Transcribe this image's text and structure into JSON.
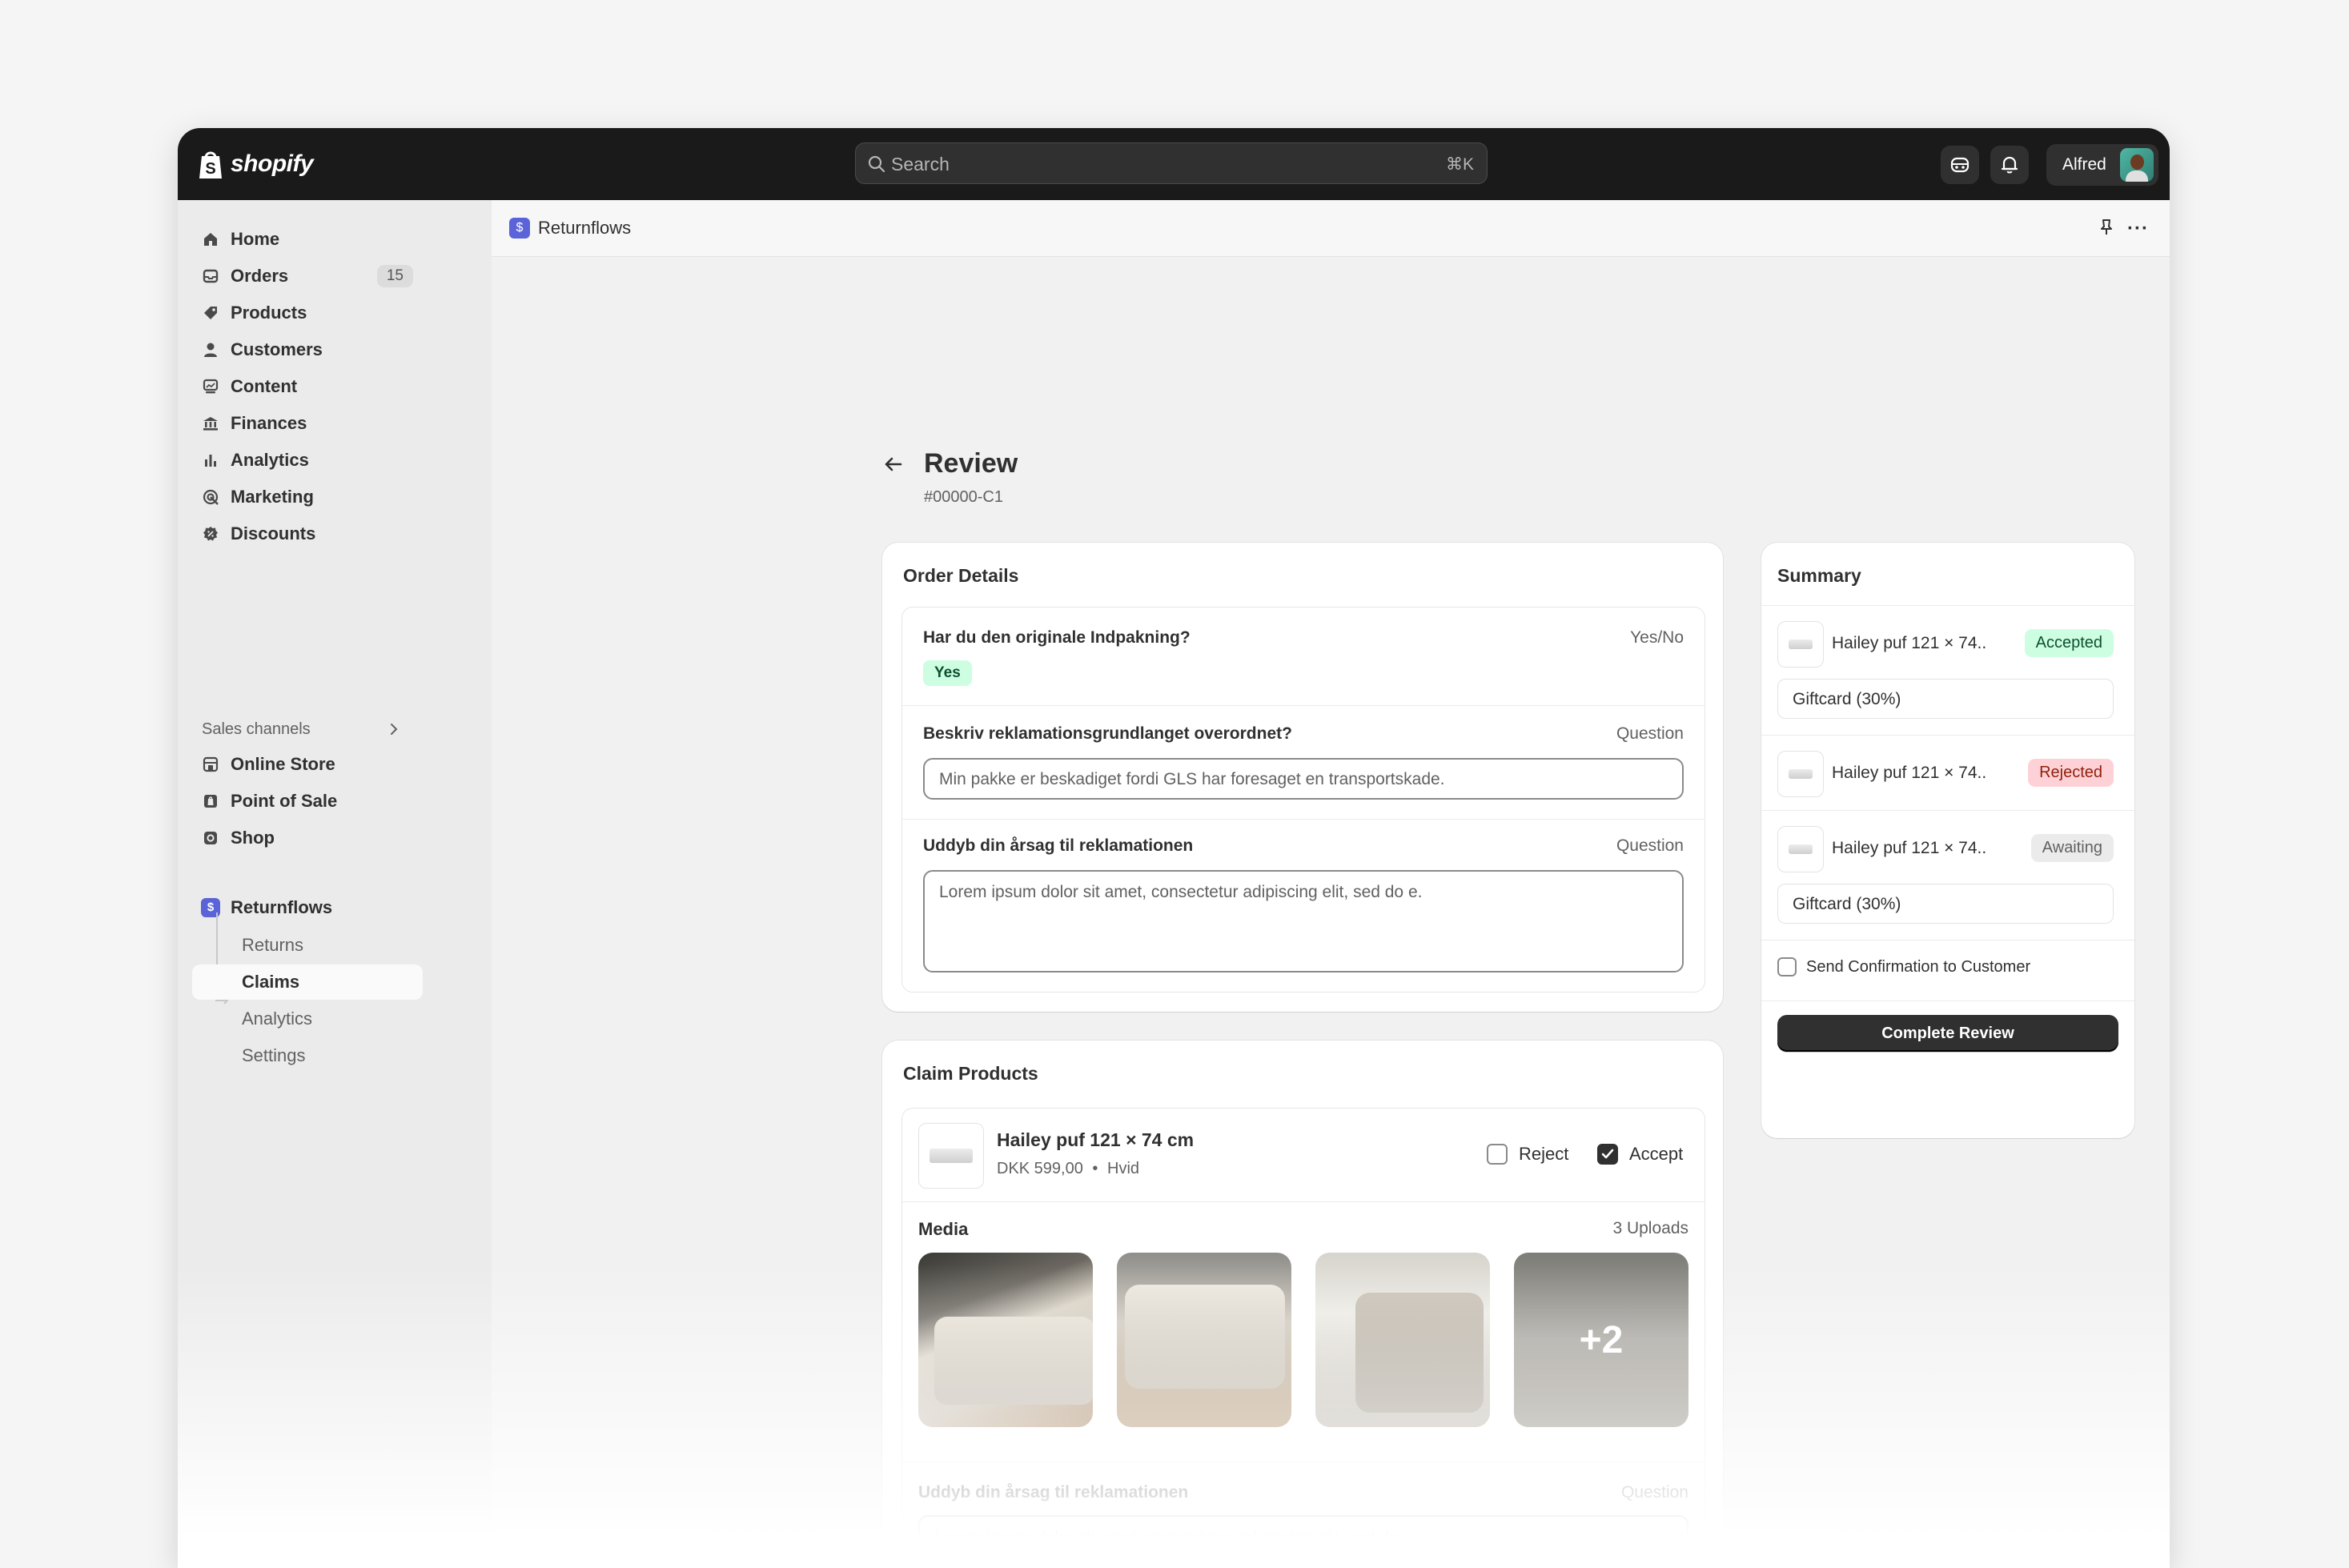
{
  "topbar": {
    "brand": "shopify",
    "search_placeholder": "Search",
    "search_shortcut": "⌘K",
    "user_name": "Alfred"
  },
  "sidebar": {
    "items": [
      {
        "label": "Home",
        "icon": "home-icon"
      },
      {
        "label": "Orders",
        "icon": "inbox-icon",
        "badge": "15"
      },
      {
        "label": "Products",
        "icon": "tag-icon"
      },
      {
        "label": "Customers",
        "icon": "person-icon"
      },
      {
        "label": "Content",
        "icon": "image-icon"
      },
      {
        "label": "Finances",
        "icon": "bank-icon"
      },
      {
        "label": "Analytics",
        "icon": "bar-chart-icon"
      },
      {
        "label": "Marketing",
        "icon": "target-icon"
      },
      {
        "label": "Discounts",
        "icon": "discount-icon"
      }
    ],
    "sales_channels_title": "Sales channels",
    "channels": [
      {
        "label": "Online Store",
        "icon": "store-icon"
      },
      {
        "label": "Point of Sale",
        "icon": "pos-icon"
      },
      {
        "label": "Shop",
        "icon": "shop-icon"
      }
    ],
    "app": {
      "label": "Returnflows",
      "subitems": [
        "Returns",
        "Claims",
        "Analytics",
        "Settings"
      ],
      "active": "Claims"
    }
  },
  "appbar": {
    "title": "Returnflows"
  },
  "page": {
    "title": "Review",
    "subtitle": "#00000-C1"
  },
  "order_details": {
    "title": "Order Details",
    "questions": [
      {
        "label": "Har du den originale Indpakning?",
        "type": "Yes/No",
        "answer": "Yes"
      },
      {
        "label": "Beskriv reklamationsgrundlanget overordnet?",
        "type": "Question",
        "answer": "Min pakke er beskadiget fordi GLS har foresaget en transportskade."
      },
      {
        "label": "Uddyb din årsag til reklamationen",
        "type": "Question",
        "answer": "Lorem ipsum dolor sit amet, consectetur adipiscing elit, sed do e."
      }
    ]
  },
  "claim_products": {
    "title": "Claim Products",
    "product": {
      "name": "Hailey puf 121 × 74 cm",
      "price": "DKK 599,00",
      "variant": "Hvid",
      "reject_label": "Reject",
      "accept_label": "Accept",
      "reject_checked": false,
      "accept_checked": true
    },
    "media_title": "Media",
    "media_count": "3 Uploads",
    "more_media": "+2",
    "question": {
      "label": "Uddyb din årsag til reklamationen",
      "type": "Question",
      "answer": "Lorem ipsum dolor sit amet, consectetur adipiscing elit, sed do e."
    }
  },
  "summary": {
    "title": "Summary",
    "items": [
      {
        "name": "Hailey puf 121 × 74..",
        "status": "Accepted",
        "gift": "Giftcard (30%)"
      },
      {
        "name": "Hailey puf 121 × 74..",
        "status": "Rejected"
      },
      {
        "name": "Hailey puf 121 × 74..",
        "status": "Awaiting",
        "gift": "Giftcard (30%)"
      }
    ],
    "confirm_label": "Send Confirmation to Customer",
    "confirm_checked": false,
    "complete_button": "Complete Review"
  },
  "colors": {
    "topbar": "#1a1a1a",
    "accepted_bg": "#cdfee1",
    "rejected_bg": "#fed1d7",
    "awaiting_bg": "#ebebeb",
    "app_icon": "#5a63d8"
  }
}
